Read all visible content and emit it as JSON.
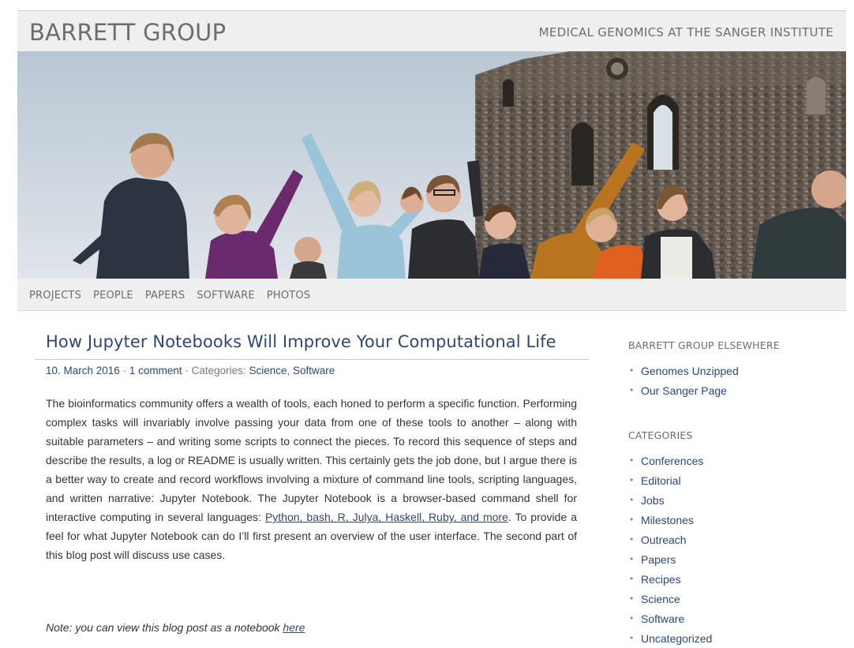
{
  "header": {
    "title": "BARRETT GROUP",
    "tagline": "MEDICAL GENOMICS AT THE SANGER INSTITUTE"
  },
  "nav": {
    "items": [
      "PROJECTS",
      "PEOPLE",
      "PAPERS",
      "SOFTWARE",
      "PHOTOS"
    ]
  },
  "post": {
    "title": "How Jupyter Notebooks Will Improve Your Computational Life",
    "date": "10. March 2016",
    "comments": "1 comment",
    "categories_prefix": "Categories:",
    "category_1": "Science",
    "category_2": "Software",
    "body_part1": "The bioinformatics community offers a wealth of tools, each honed to perform a specific function. Performing complex tasks will invariably involve passing your data from one of these tools to another – along with suitable parameters – and writing some scripts to connect the pieces. To record this sequence of steps and describe the results, a log or README is usually written. This certainly gets the job done, but I argue there is a better way to create and record workflows involving a mixture of command line tools, scripting languages, and written narrative: Jupyter Notebook. The Jupyter Notebook is a browser-based command shell for interactive computing in several languages: ",
    "body_link": "Python, bash, R, Julya, Haskell, Ruby, and more",
    "body_part2": ". To provide a feel for what Jupyter Notebook can do I’ll first present an overview of the user interface. The second part of this blog post will discuss use cases.",
    "note_text": "Note: you can view this blog post as a notebook ",
    "note_link": "here"
  },
  "sidebar": {
    "elsewhere": {
      "title": "BARRETT GROUP ELSEWHERE",
      "items": [
        "Genomes Unzipped",
        "Our Sanger Page"
      ]
    },
    "categories": {
      "title": "CATEGORIES",
      "items": [
        "Conferences",
        "Editorial",
        "Jobs",
        "Milestones",
        "Outreach",
        "Papers",
        "Recipes",
        "Science",
        "Software",
        "Uncategorized"
      ]
    }
  },
  "colors": {
    "link": "#2c4778",
    "header_bg": "#efefef",
    "header_text": "#6d6d6d",
    "sky": "#c9d4de",
    "stone": "#6b6258"
  }
}
